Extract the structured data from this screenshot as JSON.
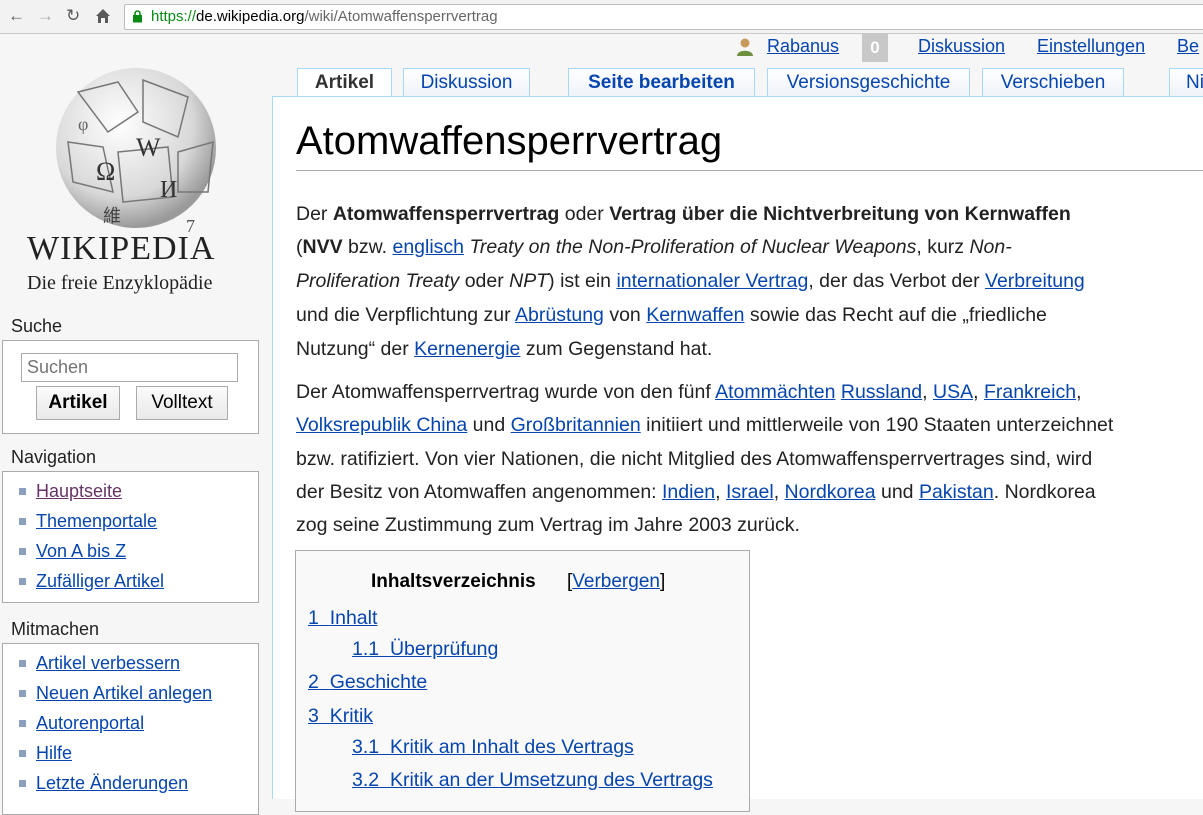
{
  "browser": {
    "url_scheme": "https://",
    "url_host": "de.wikipedia.org",
    "url_path": "/wiki/Atomwaffensperrvertrag"
  },
  "sidebar": {
    "wordmark": "WIKIPEDIA",
    "tagline": "Die freie Enzyklopädie",
    "search": {
      "heading": "Suche",
      "placeholder": "Suchen",
      "article_button": "Artikel",
      "fulltext_button": "Volltext"
    },
    "navigation": {
      "heading": "Navigation",
      "items": [
        "Hauptseite",
        "Themenportale",
        "Von A bis Z",
        "Zufälliger Artikel"
      ]
    },
    "participate": {
      "heading": "Mitmachen",
      "items": [
        "Artikel verbessern",
        "Neuen Artikel anlegen",
        "Autorenportal",
        "Hilfe",
        "Letzte Änderungen"
      ]
    }
  },
  "personal": {
    "username": "Rabanus",
    "notifications": "0",
    "talk": "Diskussion",
    "preferences": "Einstellungen",
    "more": "Be"
  },
  "tabs": {
    "article": "Artikel",
    "discussion": "Diskussion",
    "edit": "Seite bearbeiten",
    "history": "Versionsgeschichte",
    "move": "Verschieben",
    "more": "Ni"
  },
  "article": {
    "title": "Atomwaffensperrvertrag",
    "p1": {
      "a": "Der ",
      "b": "Atomwaffensperrvertrag",
      "c": " oder ",
      "d": "Vertrag über die Nichtverbreitung von Kernwaffen",
      "e": "(",
      "f": "NVV",
      "g": " bzw. ",
      "h": "englisch",
      "i": " ",
      "j": "Treaty on the Non-Proliferation of Nuclear Weapons",
      "k": ", kurz ",
      "l": "Non-",
      "m": "Proliferation Treaty",
      "n": " oder ",
      "o": "NPT",
      "p": ") ist ein ",
      "q": "internationaler Vertrag",
      "r": ", der das Verbot der ",
      "s": "Verbreitung",
      "t": "und die Verpflichtung zur ",
      "u": "Abrüstung",
      "v": " von ",
      "w": "Kernwaffen",
      "x": " sowie das Recht auf die „friedliche",
      "y": "Nutzung“ der ",
      "z": "Kernenergie",
      "z2": " zum Gegenstand hat."
    },
    "p2": {
      "a": "Der Atomwaffensperrvertrag wurde von den fünf ",
      "b": "Atommächten",
      "c": " ",
      "d": "Russland",
      "e": ", ",
      "f": "USA",
      "g": ", ",
      "h": "Frankreich",
      "i": ",",
      "j": "Volksrepublik China",
      "k": " und ",
      "l": "Großbritannien",
      "m": " initiiert und mittlerweile von 190 Staaten unterzeichnet",
      "n": "bzw. ratifiziert. Von vier Nationen, die nicht Mitglied des Atomwaffensperrvertrages sind, wird",
      "o": "der Besitz von Atomwaffen angenommen: ",
      "p": "Indien",
      "q": ", ",
      "r": "Israel",
      "s": ", ",
      "t": "Nordkorea",
      "u": " und ",
      "v": "Pakistan",
      "w": ". Nordkorea",
      "x": "zog seine Zustimmung zum Vertrag im Jahre 2003 zurück."
    },
    "toc": {
      "title": "Inhaltsverzeichnis",
      "bracket_open": "[",
      "toggle": "Verbergen",
      "bracket_close": "]",
      "items": [
        {
          "num": "1",
          "text": "Inhalt"
        },
        {
          "num": "1.1",
          "text": "Überprüfung"
        },
        {
          "num": "2",
          "text": "Geschichte"
        },
        {
          "num": "3",
          "text": "Kritik"
        },
        {
          "num": "3.1",
          "text": "Kritik am Inhalt des Vertrags"
        },
        {
          "num": "3.2",
          "text": "Kritik an der Umsetzung des Vertrags"
        }
      ]
    }
  }
}
